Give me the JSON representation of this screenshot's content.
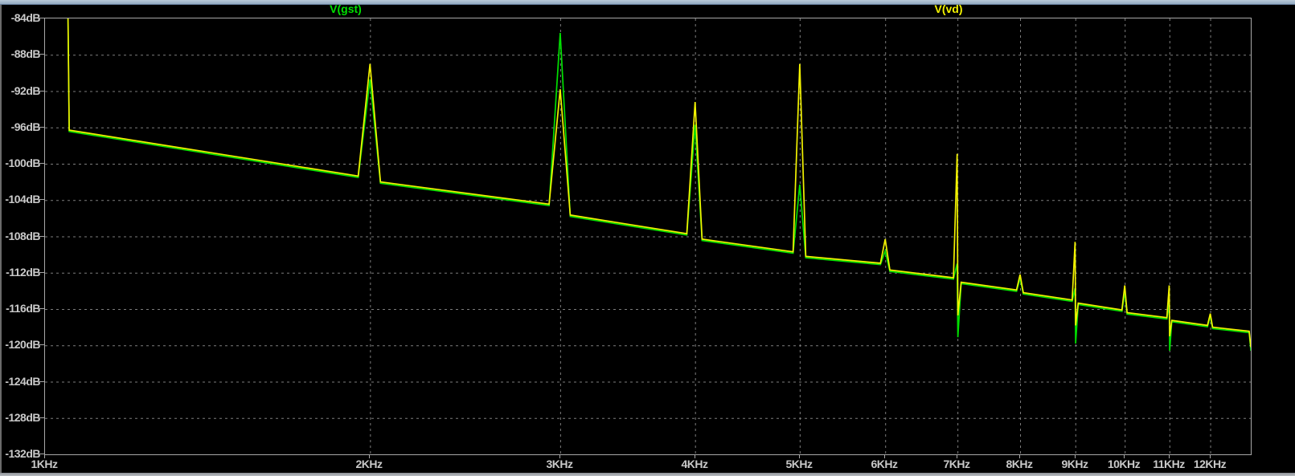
{
  "app": {
    "name": "waveform-viewer",
    "pane": "FFT plot"
  },
  "legend": [
    {
      "label": "V(gst)",
      "color": "#00e000"
    },
    {
      "label": "V(vd)",
      "color": "#f2f200"
    }
  ],
  "colors": {
    "background": "#000000",
    "plot_border": "#a8a8a8",
    "grid": "#7d7d7d",
    "axis_text": "#c9c9c9",
    "trace_green": "#00e000",
    "trace_yellow": "#f2f200"
  },
  "chart_data": {
    "type": "line",
    "title": "",
    "xlabel": "",
    "ylabel": "",
    "grid": true,
    "legend_position": "top",
    "x_axis": {
      "scale": "log",
      "unit": "KHz",
      "range_khz": [
        1,
        13.1
      ],
      "ticks": [
        {
          "label": "1KHz",
          "f": 1
        },
        {
          "label": "2KHz",
          "f": 2
        },
        {
          "label": "3KHz",
          "f": 3
        },
        {
          "label": "4KHz",
          "f": 4
        },
        {
          "label": "5KHz",
          "f": 5
        },
        {
          "label": "6KHz",
          "f": 6
        },
        {
          "label": "7KHz",
          "f": 7
        },
        {
          "label": "8KHz",
          "f": 8
        },
        {
          "label": "9KHz",
          "f": 9
        },
        {
          "label": "10KHz",
          "f": 10
        },
        {
          "label": "11KHz",
          "f": 11
        },
        {
          "label": "12KHz",
          "f": 12
        }
      ]
    },
    "y_axis": {
      "unit": "dB",
      "max": -84,
      "min": -132,
      "step": 4,
      "tick_labels": [
        "-84dB",
        "-88dB",
        "-92dB",
        "-96dB",
        "-100dB",
        "-104dB",
        "-108dB",
        "-112dB",
        "-116dB",
        "-120dB",
        "-124dB",
        "-128dB",
        "-132dB"
      ]
    },
    "series": [
      {
        "name": "V(gst)",
        "color": "#00e000",
        "points": [
          [
            1.049,
            -78
          ],
          [
            1.053,
            -96.45
          ],
          [
            1.95,
            -101.5
          ],
          [
            2.0,
            -90.7
          ],
          [
            2.045,
            -102.15
          ],
          [
            2.93,
            -104.6
          ],
          [
            3.0,
            -85.6
          ],
          [
            3.065,
            -105.8
          ],
          [
            3.93,
            -107.85
          ],
          [
            4.0,
            -95.7
          ],
          [
            4.06,
            -108.45
          ],
          [
            4.93,
            -109.85
          ],
          [
            5.0,
            -102.3
          ],
          [
            5.065,
            -110.35
          ],
          [
            5.94,
            -111.1
          ],
          [
            6.0,
            -109.6
          ],
          [
            6.06,
            -111.85
          ],
          [
            6.94,
            -112.7
          ],
          [
            6.995,
            -111.0
          ],
          [
            7.005,
            -119.1
          ],
          [
            7.055,
            -113.2
          ],
          [
            7.94,
            -114.05
          ],
          [
            8.0,
            -112.6
          ],
          [
            8.055,
            -114.35
          ],
          [
            8.94,
            -115.15
          ],
          [
            8.995,
            -113.7
          ],
          [
            9.005,
            -119.8
          ],
          [
            9.055,
            -115.5
          ],
          [
            9.94,
            -116.25
          ],
          [
            10.0,
            -114.1
          ],
          [
            10.05,
            -116.55
          ],
          [
            10.94,
            -117.1
          ],
          [
            10.995,
            -115.3
          ],
          [
            11.005,
            -120.6
          ],
          [
            11.055,
            -117.4
          ],
          [
            11.93,
            -117.95
          ],
          [
            12.0,
            -116.8
          ],
          [
            12.06,
            -118.15
          ],
          [
            13.04,
            -118.6
          ],
          [
            13.085,
            -120.6
          ]
        ]
      },
      {
        "name": "V(vd)",
        "color": "#f2f200",
        "points": [
          [
            1.049,
            -78
          ],
          [
            1.053,
            -96.3
          ],
          [
            1.95,
            -101.35
          ],
          [
            2.0,
            -89.0
          ],
          [
            2.045,
            -102.0
          ],
          [
            2.93,
            -104.45
          ],
          [
            3.0,
            -91.8
          ],
          [
            3.065,
            -105.65
          ],
          [
            3.93,
            -107.7
          ],
          [
            4.0,
            -93.2
          ],
          [
            4.06,
            -108.3
          ],
          [
            4.93,
            -109.7
          ],
          [
            5.0,
            -89.0
          ],
          [
            5.065,
            -110.2
          ],
          [
            5.94,
            -110.95
          ],
          [
            6.0,
            -108.3
          ],
          [
            6.06,
            -111.7
          ],
          [
            6.94,
            -112.55
          ],
          [
            6.995,
            -98.9
          ],
          [
            7.005,
            -116.7
          ],
          [
            7.055,
            -113.05
          ],
          [
            7.94,
            -113.9
          ],
          [
            8.0,
            -112.2
          ],
          [
            8.055,
            -114.2
          ],
          [
            8.94,
            -115.0
          ],
          [
            8.995,
            -108.6
          ],
          [
            9.005,
            -117.8
          ],
          [
            9.055,
            -115.35
          ],
          [
            9.94,
            -116.1
          ],
          [
            10.0,
            -113.4
          ],
          [
            10.05,
            -116.4
          ],
          [
            10.94,
            -116.95
          ],
          [
            10.995,
            -113.4
          ],
          [
            11.005,
            -119.0
          ],
          [
            11.055,
            -117.25
          ],
          [
            11.93,
            -117.8
          ],
          [
            12.0,
            -116.5
          ],
          [
            12.06,
            -118.0
          ],
          [
            13.04,
            -118.45
          ],
          [
            13.085,
            -120.2
          ]
        ]
      }
    ]
  }
}
